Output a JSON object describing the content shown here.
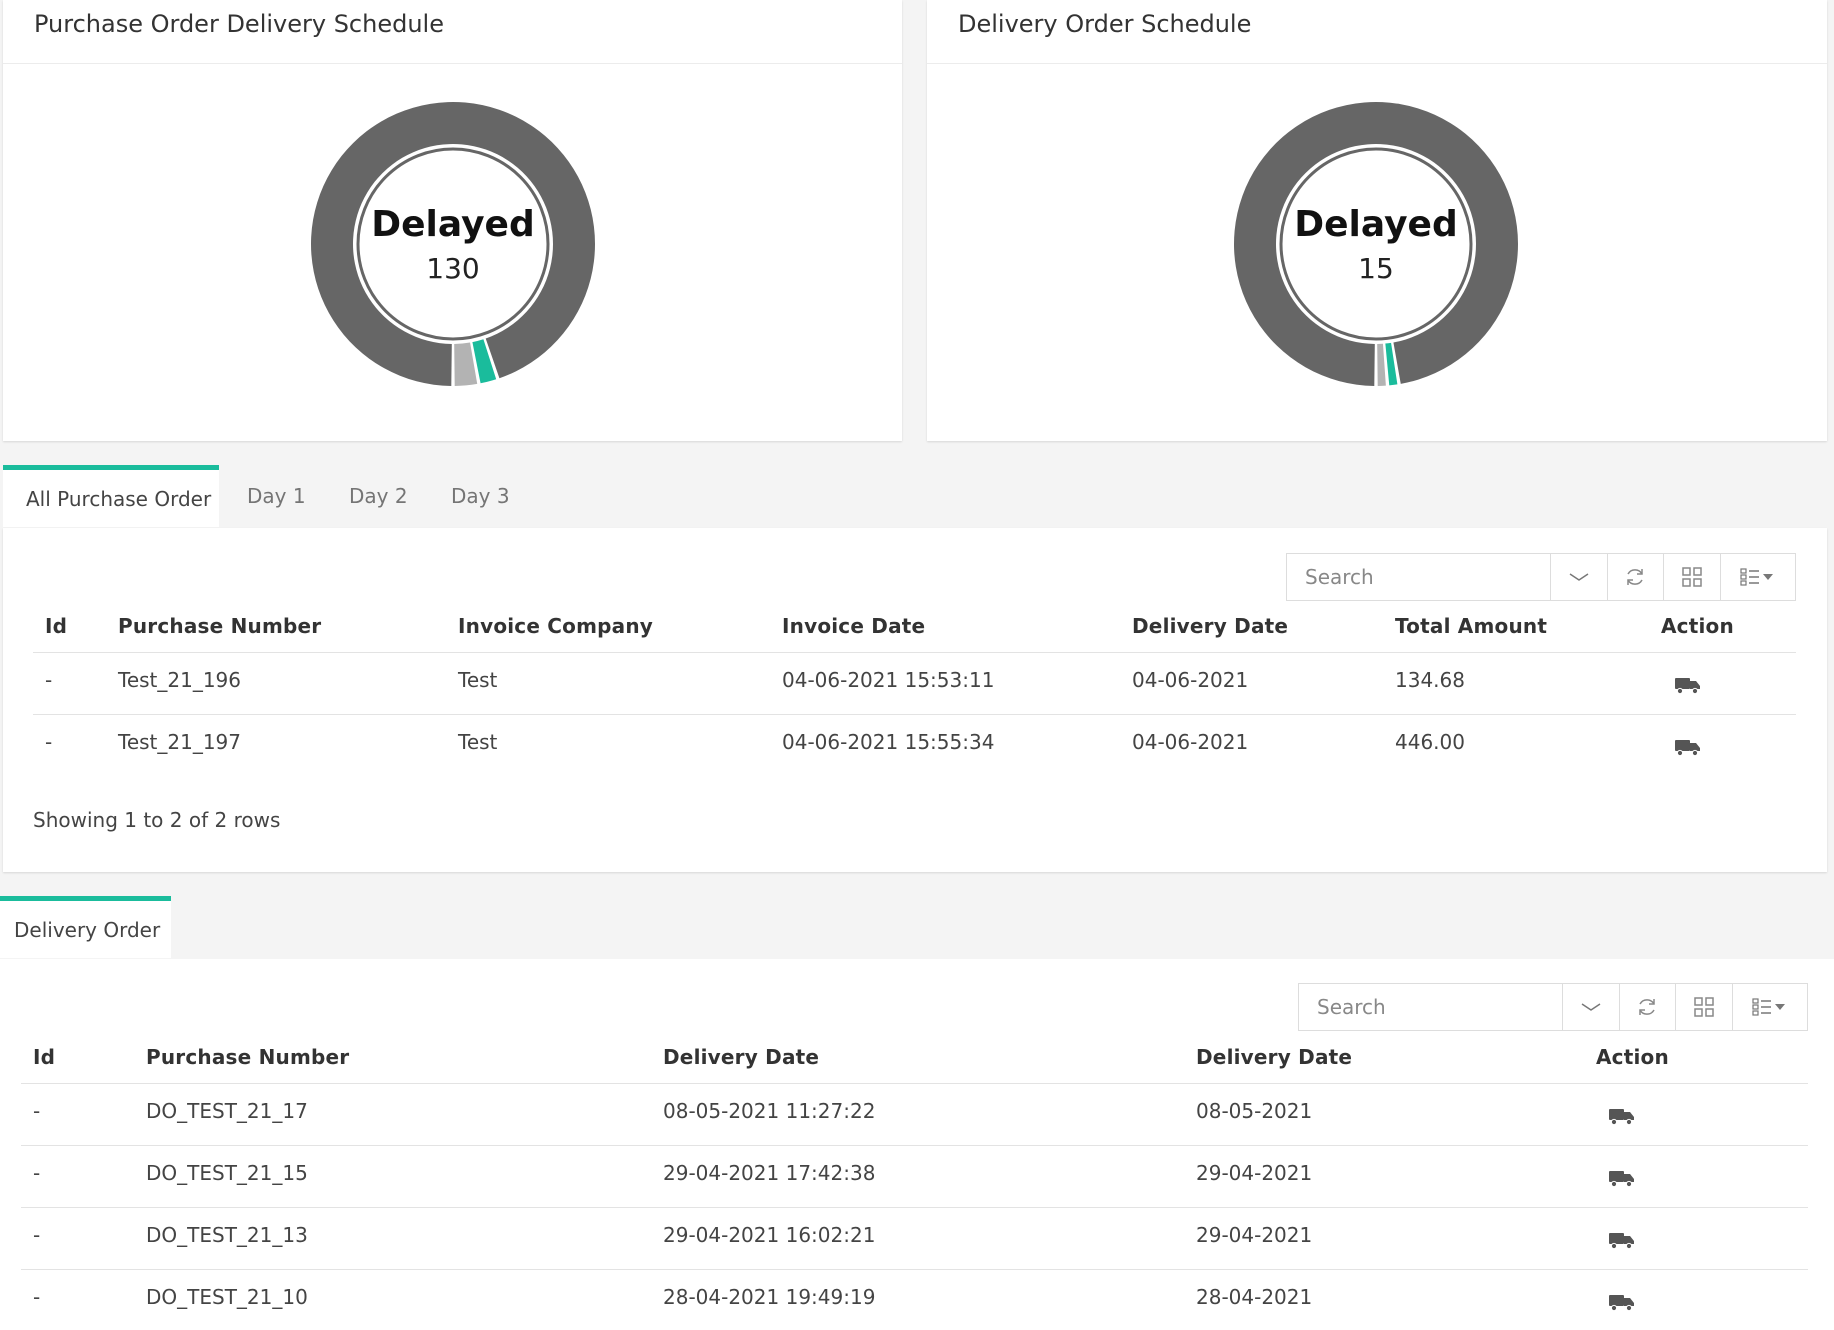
{
  "po_chart": {
    "title": "Purchase Order Delivery Schedule",
    "center_label": "Delayed",
    "center_value": "130",
    "colors": {
      "delayed": "#666666",
      "ontime": "#1abc9c",
      "pending": "#b3b3b3"
    }
  },
  "do_chart": {
    "title": "Delivery Order Schedule",
    "center_label": "Delayed",
    "center_value": "15",
    "colors": {
      "delayed": "#666666",
      "ontime": "#1abc9c",
      "pending": "#b3b3b3"
    }
  },
  "chart_data": [
    {
      "type": "pie",
      "title": "Purchase Order Delivery Schedule",
      "values": [
        130,
        3,
        4
      ],
      "center_text": "Delayed 130"
    },
    {
      "type": "pie",
      "title": "Delivery Order Schedule",
      "values": [
        15,
        0.2,
        0.2
      ],
      "center_text": "Delayed 15"
    }
  ],
  "po_tabs": [
    "All Purchase Order",
    "Day 1",
    "Day 2",
    "Day 3"
  ],
  "po_table": {
    "search_placeholder": "Search",
    "headers": [
      "Id",
      "Purchase Number",
      "Invoice Company",
      "Invoice Date",
      "Delivery Date",
      "Total Amount",
      "Action"
    ],
    "rows": [
      [
        "-",
        "Test_21_196",
        "Test",
        "04-06-2021 15:53:11",
        "04-06-2021",
        "134.68"
      ],
      [
        "-",
        "Test_21_197",
        "Test",
        "04-06-2021 15:55:34",
        "04-06-2021",
        "446.00"
      ]
    ],
    "footer": "Showing 1 to 2 of 2 rows"
  },
  "do_tabs": [
    "Delivery Order"
  ],
  "do_table": {
    "search_placeholder": "Search",
    "headers": [
      "Id",
      "Purchase Number",
      "Delivery Date",
      "Delivery Date",
      "Action"
    ],
    "rows": [
      [
        "-",
        "DO_TEST_21_17",
        "08-05-2021 11:27:22",
        "08-05-2021"
      ],
      [
        "-",
        "DO_TEST_21_15",
        "29-04-2021 17:42:38",
        "29-04-2021"
      ],
      [
        "-",
        "DO_TEST_21_13",
        "29-04-2021 16:02:21",
        "29-04-2021"
      ],
      [
        "-",
        "DO_TEST_21_10",
        "28-04-2021 19:49:19",
        "28-04-2021"
      ]
    ]
  },
  "icons": {
    "toolbar": [
      "chevron-down-icon",
      "refresh-icon",
      "grid-icon",
      "column-list-icon"
    ],
    "action": "truck-icon"
  }
}
